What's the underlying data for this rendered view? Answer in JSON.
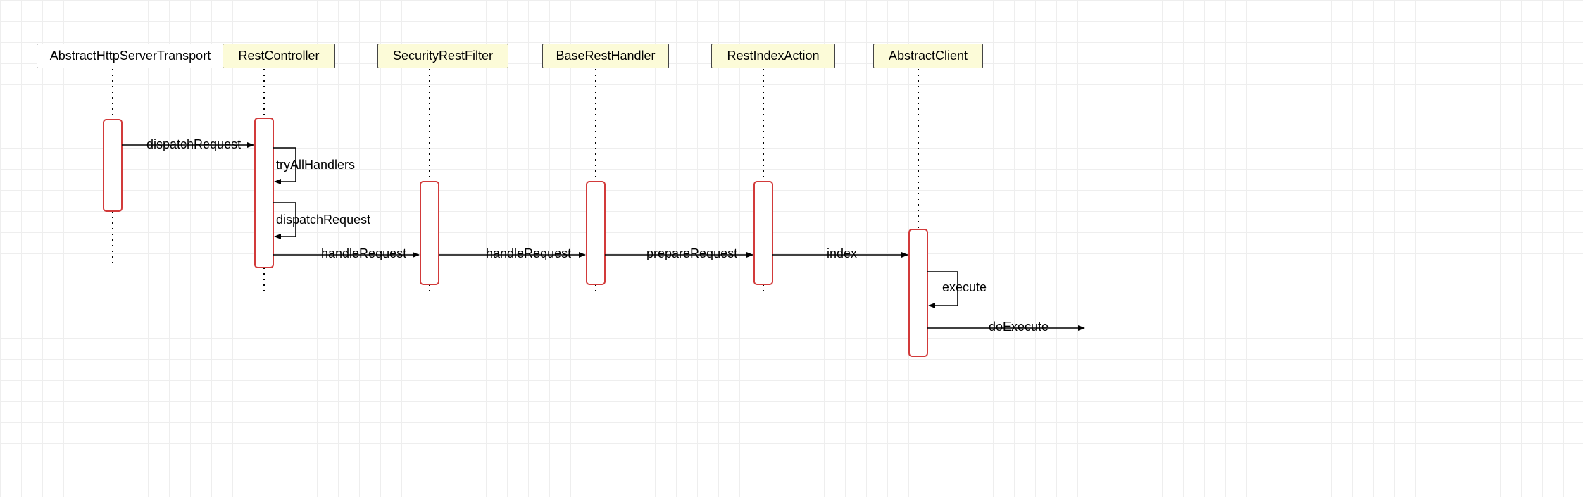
{
  "participants": {
    "p1": {
      "label": "AbstractHttpServerTransport",
      "highlight": false
    },
    "p2": {
      "label": "RestController",
      "highlight": true
    },
    "p3": {
      "label": "SecurityRestFilter",
      "highlight": true
    },
    "p4": {
      "label": "BaseRestHandler",
      "highlight": true
    },
    "p5": {
      "label": "RestIndexAction",
      "highlight": true
    },
    "p6": {
      "label": "AbstractClient",
      "highlight": true
    }
  },
  "messages": {
    "m1": "dispatchRequest",
    "m2": "tryAllHandlers",
    "m3": "dispatchRequest",
    "m4": "handleRequest",
    "m5": "handleRequest",
    "m6": "prepareRequest",
    "m7": "index",
    "m8": "execute",
    "m9": "doExecute"
  }
}
